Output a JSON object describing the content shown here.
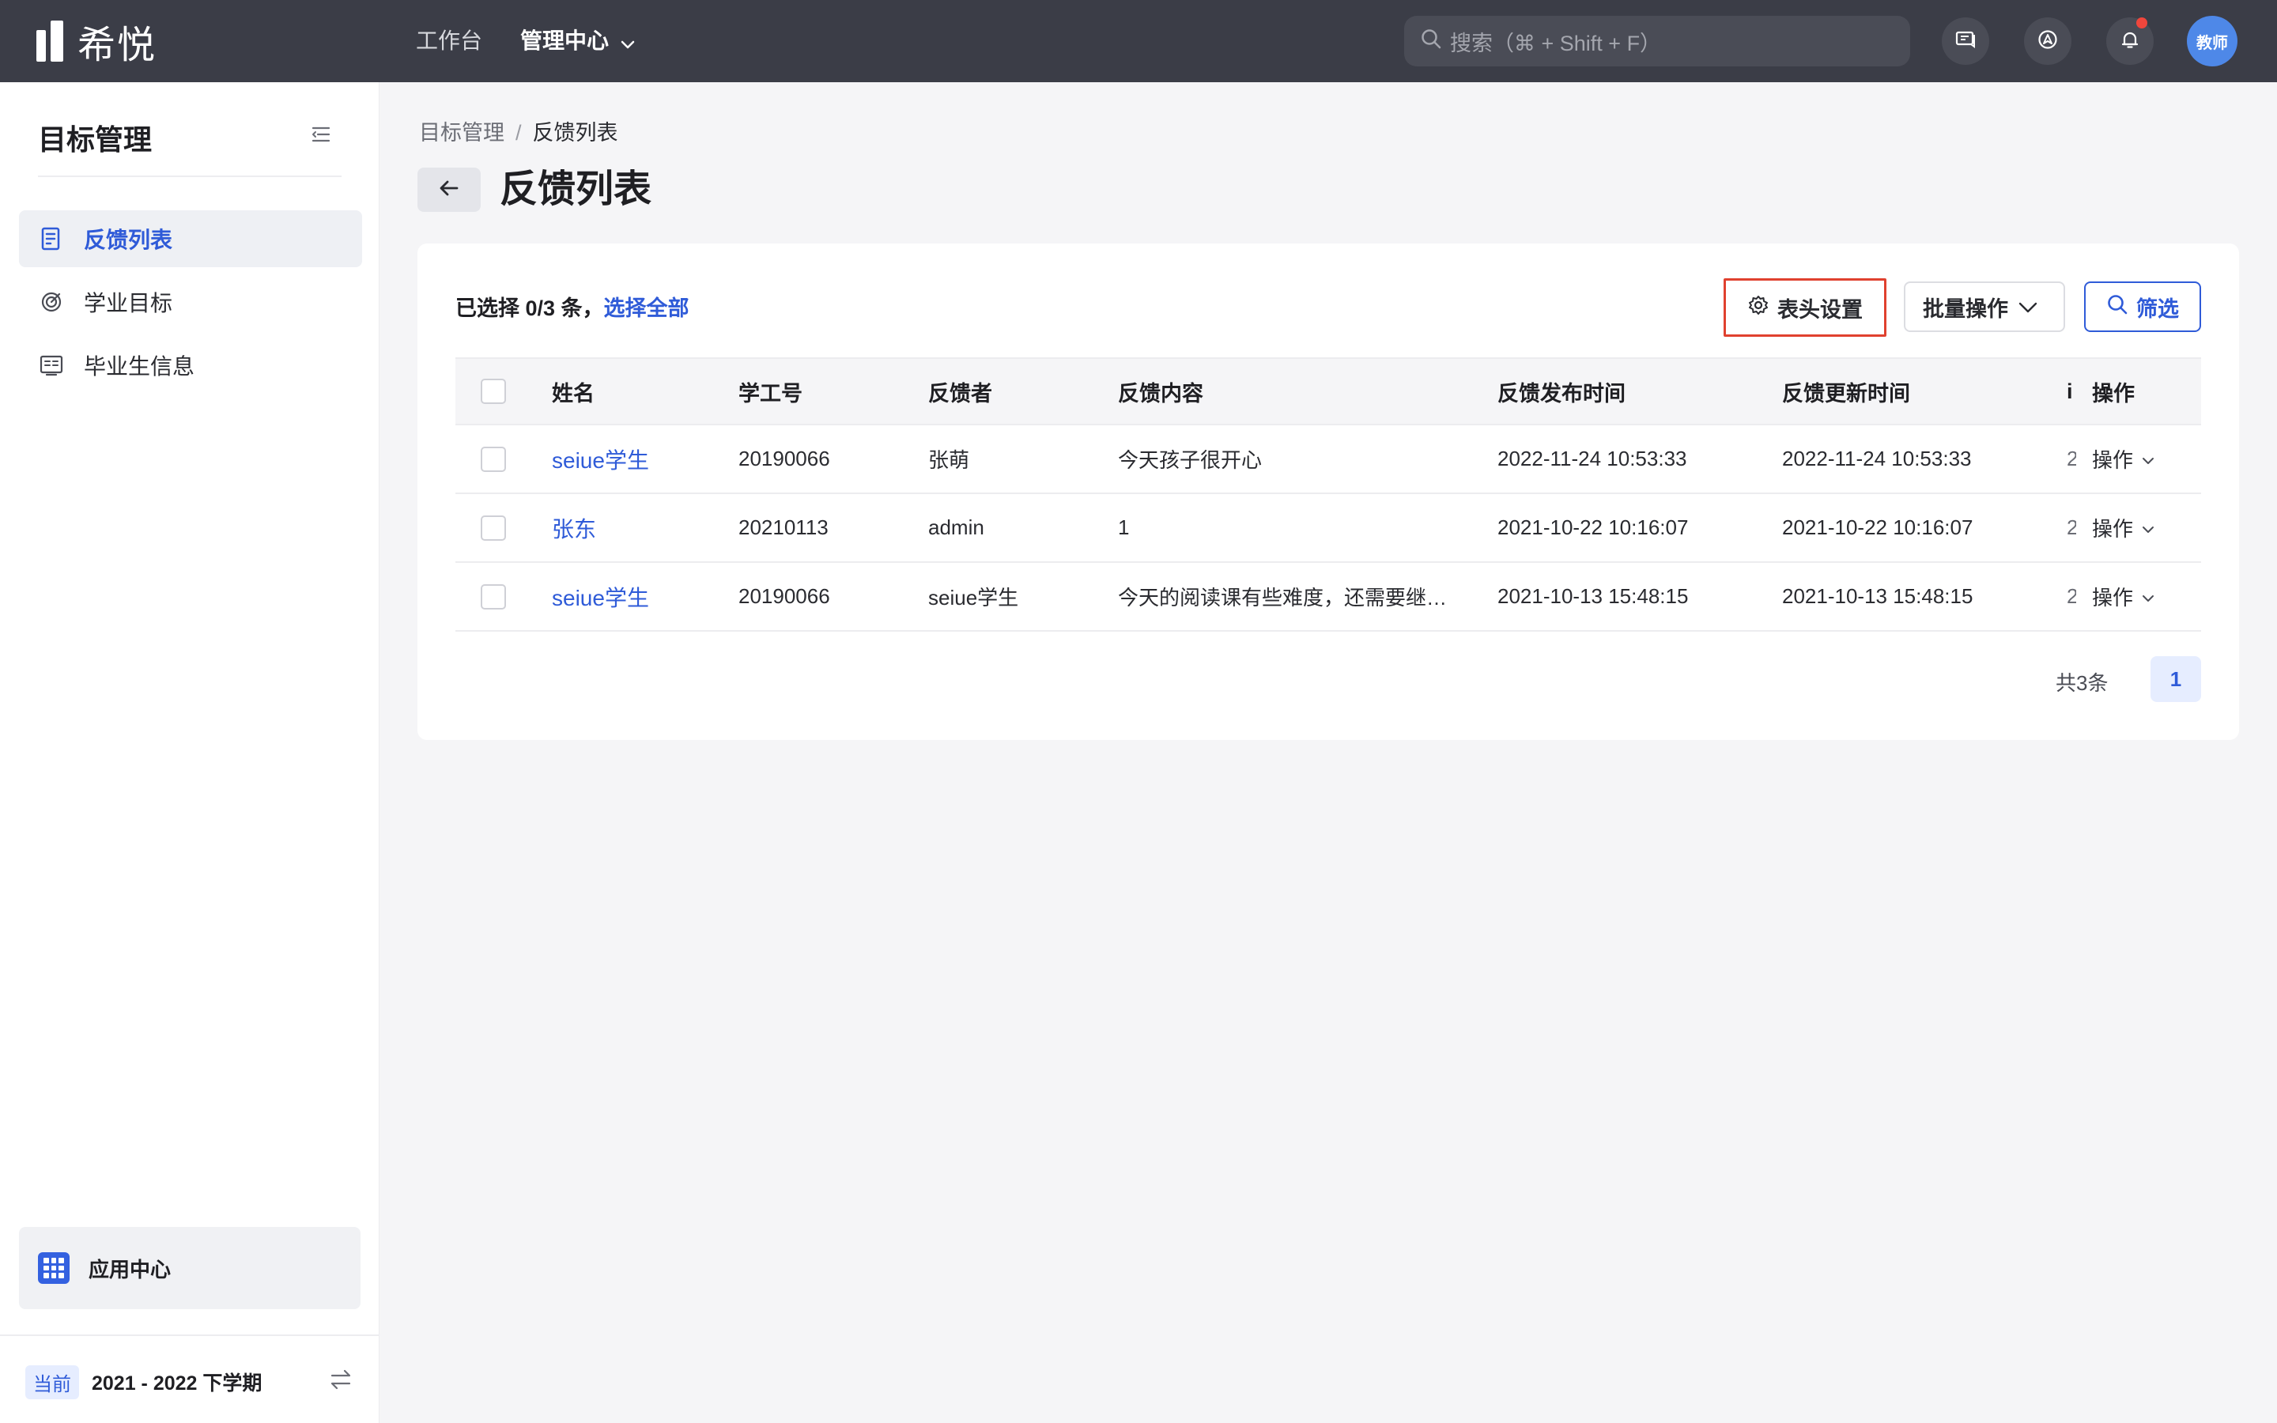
{
  "brand": {
    "name": "希悦"
  },
  "topnav": {
    "items": [
      {
        "label": "工作台"
      },
      {
        "label": "管理中心"
      }
    ]
  },
  "search": {
    "placeholder": "搜索（⌘ + Shift + F）"
  },
  "user": {
    "avatar_text": "教师"
  },
  "sidebar": {
    "title": "目标管理",
    "items": [
      {
        "label": "反馈列表",
        "icon": "document-list-icon",
        "active": true
      },
      {
        "label": "学业目标",
        "icon": "target-icon",
        "active": false
      },
      {
        "label": "毕业生信息",
        "icon": "profile-card-icon",
        "active": false
      }
    ],
    "app_center": "应用中心",
    "term_badge": "当前",
    "term": "2021 - 2022 下学期"
  },
  "breadcrumb": {
    "parent": "目标管理",
    "separator": "/",
    "current": "反馈列表"
  },
  "page": {
    "title": "反馈列表"
  },
  "toolbar": {
    "selection_prefix": "已选择 0/3 条，",
    "select_all": "选择全部",
    "column_settings": "表头设置",
    "batch_ops": "批量操作",
    "filter": "筛选"
  },
  "table": {
    "headers": {
      "name": "姓名",
      "id": "学工号",
      "feedbacker": "反馈者",
      "content": "反馈内容",
      "published": "反馈发布时间",
      "updated": "反馈更新时间",
      "truncated": "i",
      "actions": "操作"
    },
    "rows": [
      {
        "name": "seiue学生",
        "id": "20190066",
        "feedbacker": "张萌",
        "content": "今天孩子很开心",
        "published": "2022-11-24 10:53:33",
        "updated": "2022-11-24 10:53:33",
        "truncated": "2",
        "action": "操作"
      },
      {
        "name": "张东",
        "id": "20210113",
        "feedbacker": "admin",
        "content": "1",
        "published": "2021-10-22 10:16:07",
        "updated": "2021-10-22 10:16:07",
        "truncated": "2",
        "action": "操作"
      },
      {
        "name": "seiue学生",
        "id": "20190066",
        "feedbacker": "seiue学生",
        "content": "今天的阅读课有些难度，还需要继续加油",
        "published": "2021-10-13 15:48:15",
        "updated": "2021-10-13 15:48:15",
        "truncated": "2",
        "action": "操作"
      }
    ]
  },
  "pagination": {
    "total": "共3条",
    "current_page": "1"
  },
  "colors": {
    "accent": "#2f5bd8",
    "topbar": "#3b3d47",
    "highlight": "#e0412f",
    "notification_dot": "#f0463c"
  }
}
